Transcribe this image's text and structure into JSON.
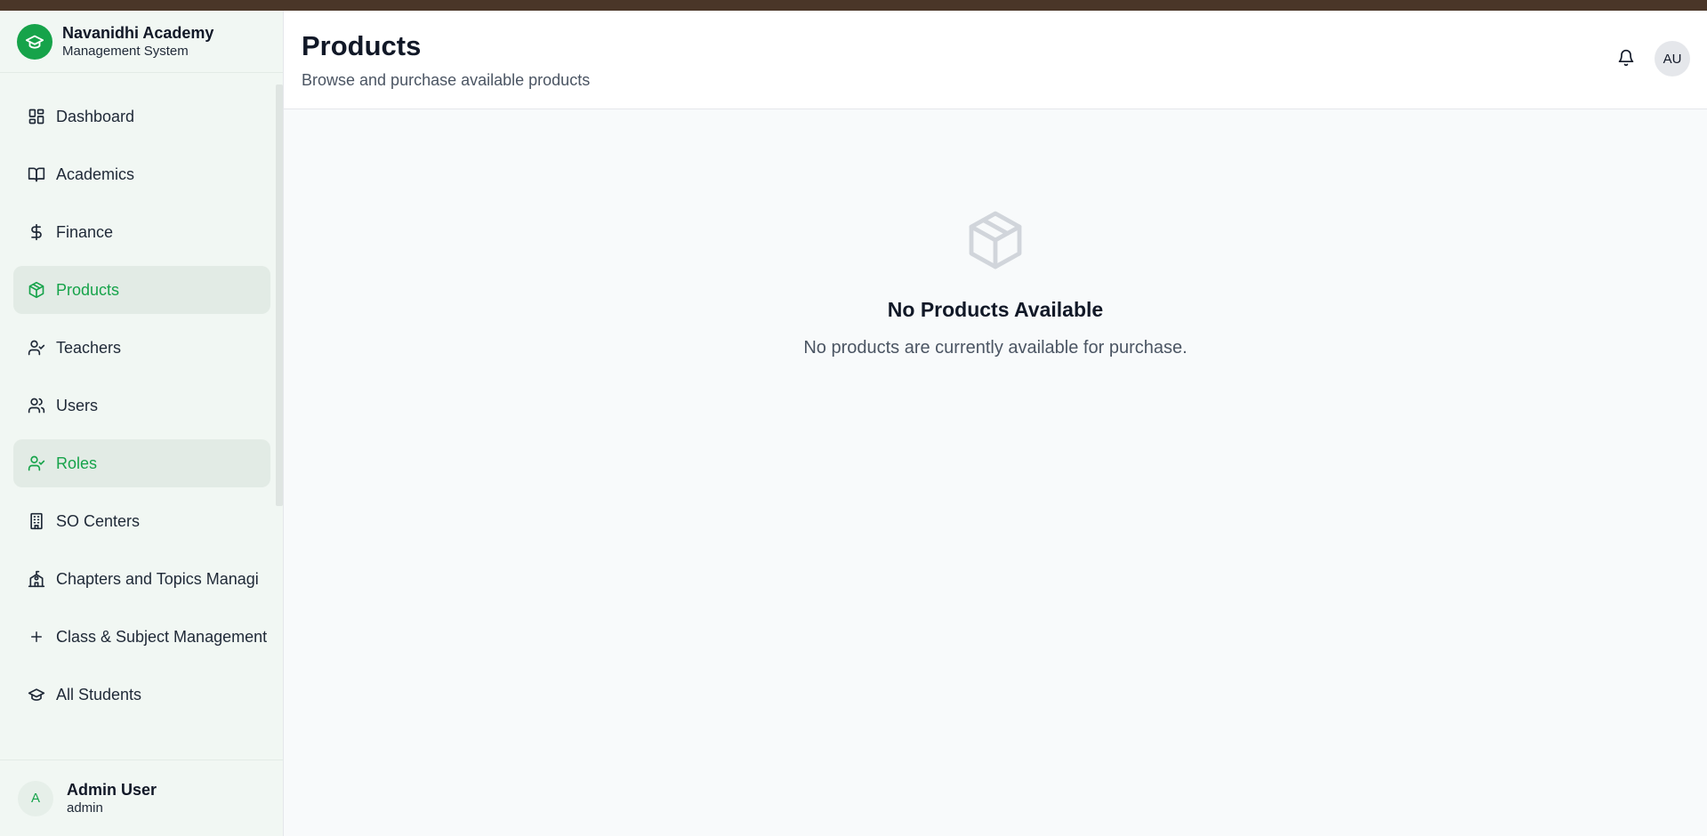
{
  "brand": {
    "name": "Navanidhi Academy",
    "subtitle": "Management System"
  },
  "sidebar": {
    "items": [
      {
        "label": "Dashboard",
        "icon": "dashboard-icon",
        "active": false
      },
      {
        "label": "Academics",
        "icon": "book-icon",
        "active": false
      },
      {
        "label": "Finance",
        "icon": "dollar-icon",
        "active": false
      },
      {
        "label": "Products",
        "icon": "package-icon",
        "active": true
      },
      {
        "label": "Teachers",
        "icon": "user-check-icon",
        "active": false
      },
      {
        "label": "Users",
        "icon": "users-icon",
        "active": false
      },
      {
        "label": "Roles",
        "icon": "user-check-icon",
        "active": true
      },
      {
        "label": "SO Centers",
        "icon": "building-icon",
        "active": false
      },
      {
        "label": "Chapters and Topics Managi",
        "icon": "school-icon",
        "active": false
      },
      {
        "label": "Class & Subject Management",
        "icon": "plus-icon",
        "active": false
      },
      {
        "label": "All Students",
        "icon": "graduation-cap-icon",
        "active": false
      }
    ]
  },
  "user": {
    "initial": "A",
    "name": "Admin User",
    "role": "admin"
  },
  "header": {
    "title": "Products",
    "subtitle": "Browse and purchase available products",
    "avatar_initials": "AU"
  },
  "empty_state": {
    "title": "No Products Available",
    "message": "No products are currently available for purchase."
  },
  "colors": {
    "accent": "#16a34a",
    "sidebar_bg": "#f1f7f3",
    "active_bg": "#e2ebe5",
    "topbar": "#4a3628"
  }
}
